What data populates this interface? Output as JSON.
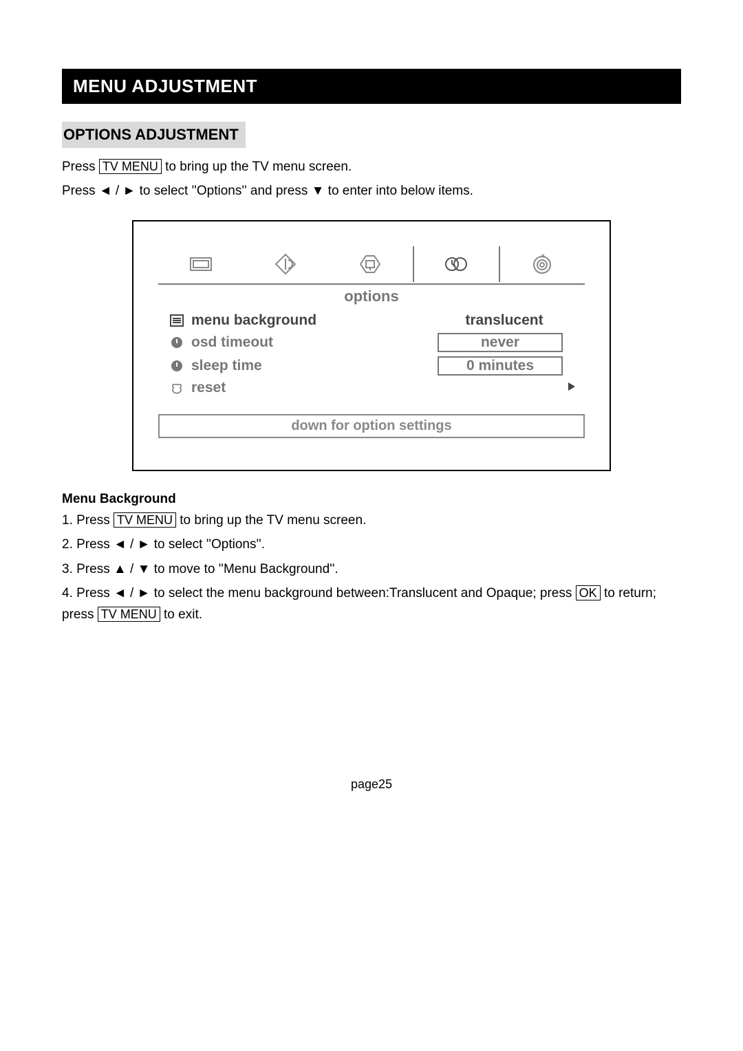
{
  "header": {
    "title": "MENU ADJUSTMENT"
  },
  "section": {
    "title": "OPTIONS ADJUSTMENT"
  },
  "intro": {
    "line1a": "Press ",
    "key1": "TV MENU",
    "line1b": " to bring up the TV menu screen.",
    "line2": "Press ◄ / ► to select ''Options'' and press ▼ to enter into below items."
  },
  "osd": {
    "title": "options",
    "items": [
      {
        "label": "menu background",
        "value": "translucent",
        "boxed": false,
        "dark": true
      },
      {
        "label": "osd timeout",
        "value": "never",
        "boxed": true
      },
      {
        "label": "sleep time",
        "value": "0 minutes",
        "boxed": true
      },
      {
        "label": "reset",
        "value": "",
        "arrow": true
      }
    ],
    "footer": "down for option settings"
  },
  "menubg": {
    "heading": "Menu Background",
    "s1a": "1. Press ",
    "s1key": "TV MENU",
    "s1b": " to bring up the TV menu screen.",
    "s2": "2. Press ◄ / ► to select ''Options''.",
    "s3": "3. Press ▲ / ▼ to move to ''Menu Background''.",
    "s4a": "4. Press ◄ / ► to select the menu background between:Translucent and Opaque; press ",
    "s4ok": "OK",
    "s4b": " to return; press ",
    "s4tv": "TV MENU",
    "s4c": " to exit."
  },
  "pagenum": "page25"
}
